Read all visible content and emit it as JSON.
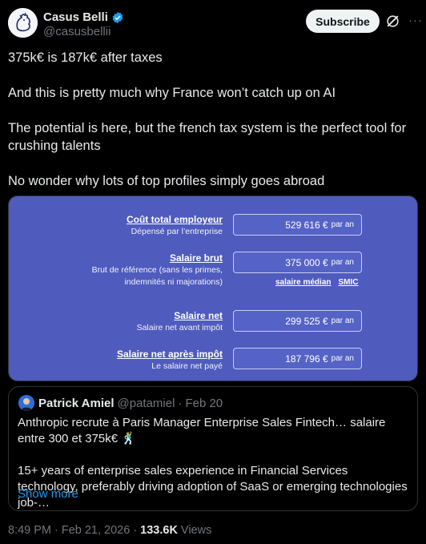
{
  "author": {
    "name": "Casus Belli",
    "handle": "@casusbellii",
    "subscribe_label": "Subscribe"
  },
  "tweet": {
    "paragraphs": [
      "375k€ is 187k€ after taxes",
      "And this is pretty much why France won’t catch up on AI",
      "The potential is here, but the french tax system is the perfect tool for crushing talents",
      "No wonder why lots of top profiles simply goes abroad"
    ]
  },
  "calculator": {
    "rows": [
      {
        "title": "Coût total employeur",
        "sub": "Dépensé par l’entreprise",
        "value": "529 616 €",
        "unit": "par an"
      },
      {
        "title": "Salaire brut",
        "sub": "Brut de référence (sans les primes,",
        "sub2": "indemnités ni majorations)",
        "value": "375 000 €",
        "unit": "par an"
      },
      {
        "title": "Salaire net",
        "sub": "Salaire net avant impôt",
        "value": "299 525 €",
        "unit": "par an"
      },
      {
        "title": "Salaire net après impôt",
        "sub": "Le salaire net payé",
        "value": "187 796 €",
        "unit": "par an"
      }
    ],
    "links": [
      "salaire médian",
      "SMIC"
    ],
    "background_color": "#4f5bbd"
  },
  "quote": {
    "name": "Patrick Amiel",
    "handle": "@patamiel",
    "date": "Feb 20",
    "separator": "·",
    "paragraphs": [
      "Anthropic recrute à Paris Manager Enterprise Sales Fintech… salaire entre 300 et 375k€ 🕺",
      "15+ years of enterprise sales experience in Financial Services technology, preferably driving adoption of SaaS or emerging technologies job-…"
    ],
    "show_more": "Show more"
  },
  "footer": {
    "time": "8:49 PM",
    "date": "Feb 21, 2026",
    "separator": "·",
    "views_count": "133.6K",
    "views_label": "Views"
  },
  "colors": {
    "accent": "#1d9bf0",
    "background": "#000000",
    "muted": "#71767b"
  }
}
